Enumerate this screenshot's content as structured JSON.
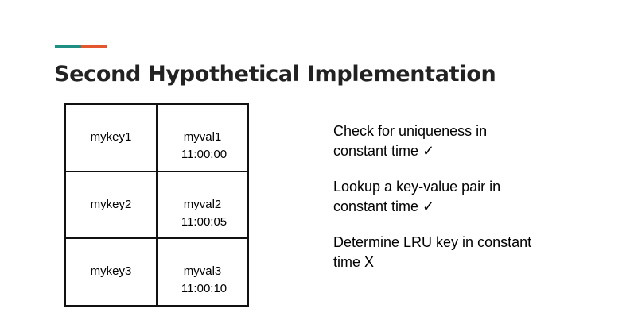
{
  "slide": {
    "title": "Second Hypothetical Implementation",
    "accent_colors": [
      "#1f8f83",
      "#e4572e"
    ]
  },
  "table": {
    "rows": [
      {
        "key": "mykey1",
        "value": "myval1",
        "timestamp": "11:00:00"
      },
      {
        "key": "mykey2",
        "value": "myval2",
        "timestamp": "11:00:05"
      },
      {
        "key": "mykey3",
        "value": "myval3",
        "timestamp": "11:00:10"
      }
    ]
  },
  "bullets": [
    {
      "line1": "Check for uniqueness in",
      "line2": "constant time ✓"
    },
    {
      "line1": "Lookup a key-value pair in",
      "line2": "constant time ✓"
    },
    {
      "line1": "Determine LRU key in constant",
      "line2": "time X"
    }
  ]
}
